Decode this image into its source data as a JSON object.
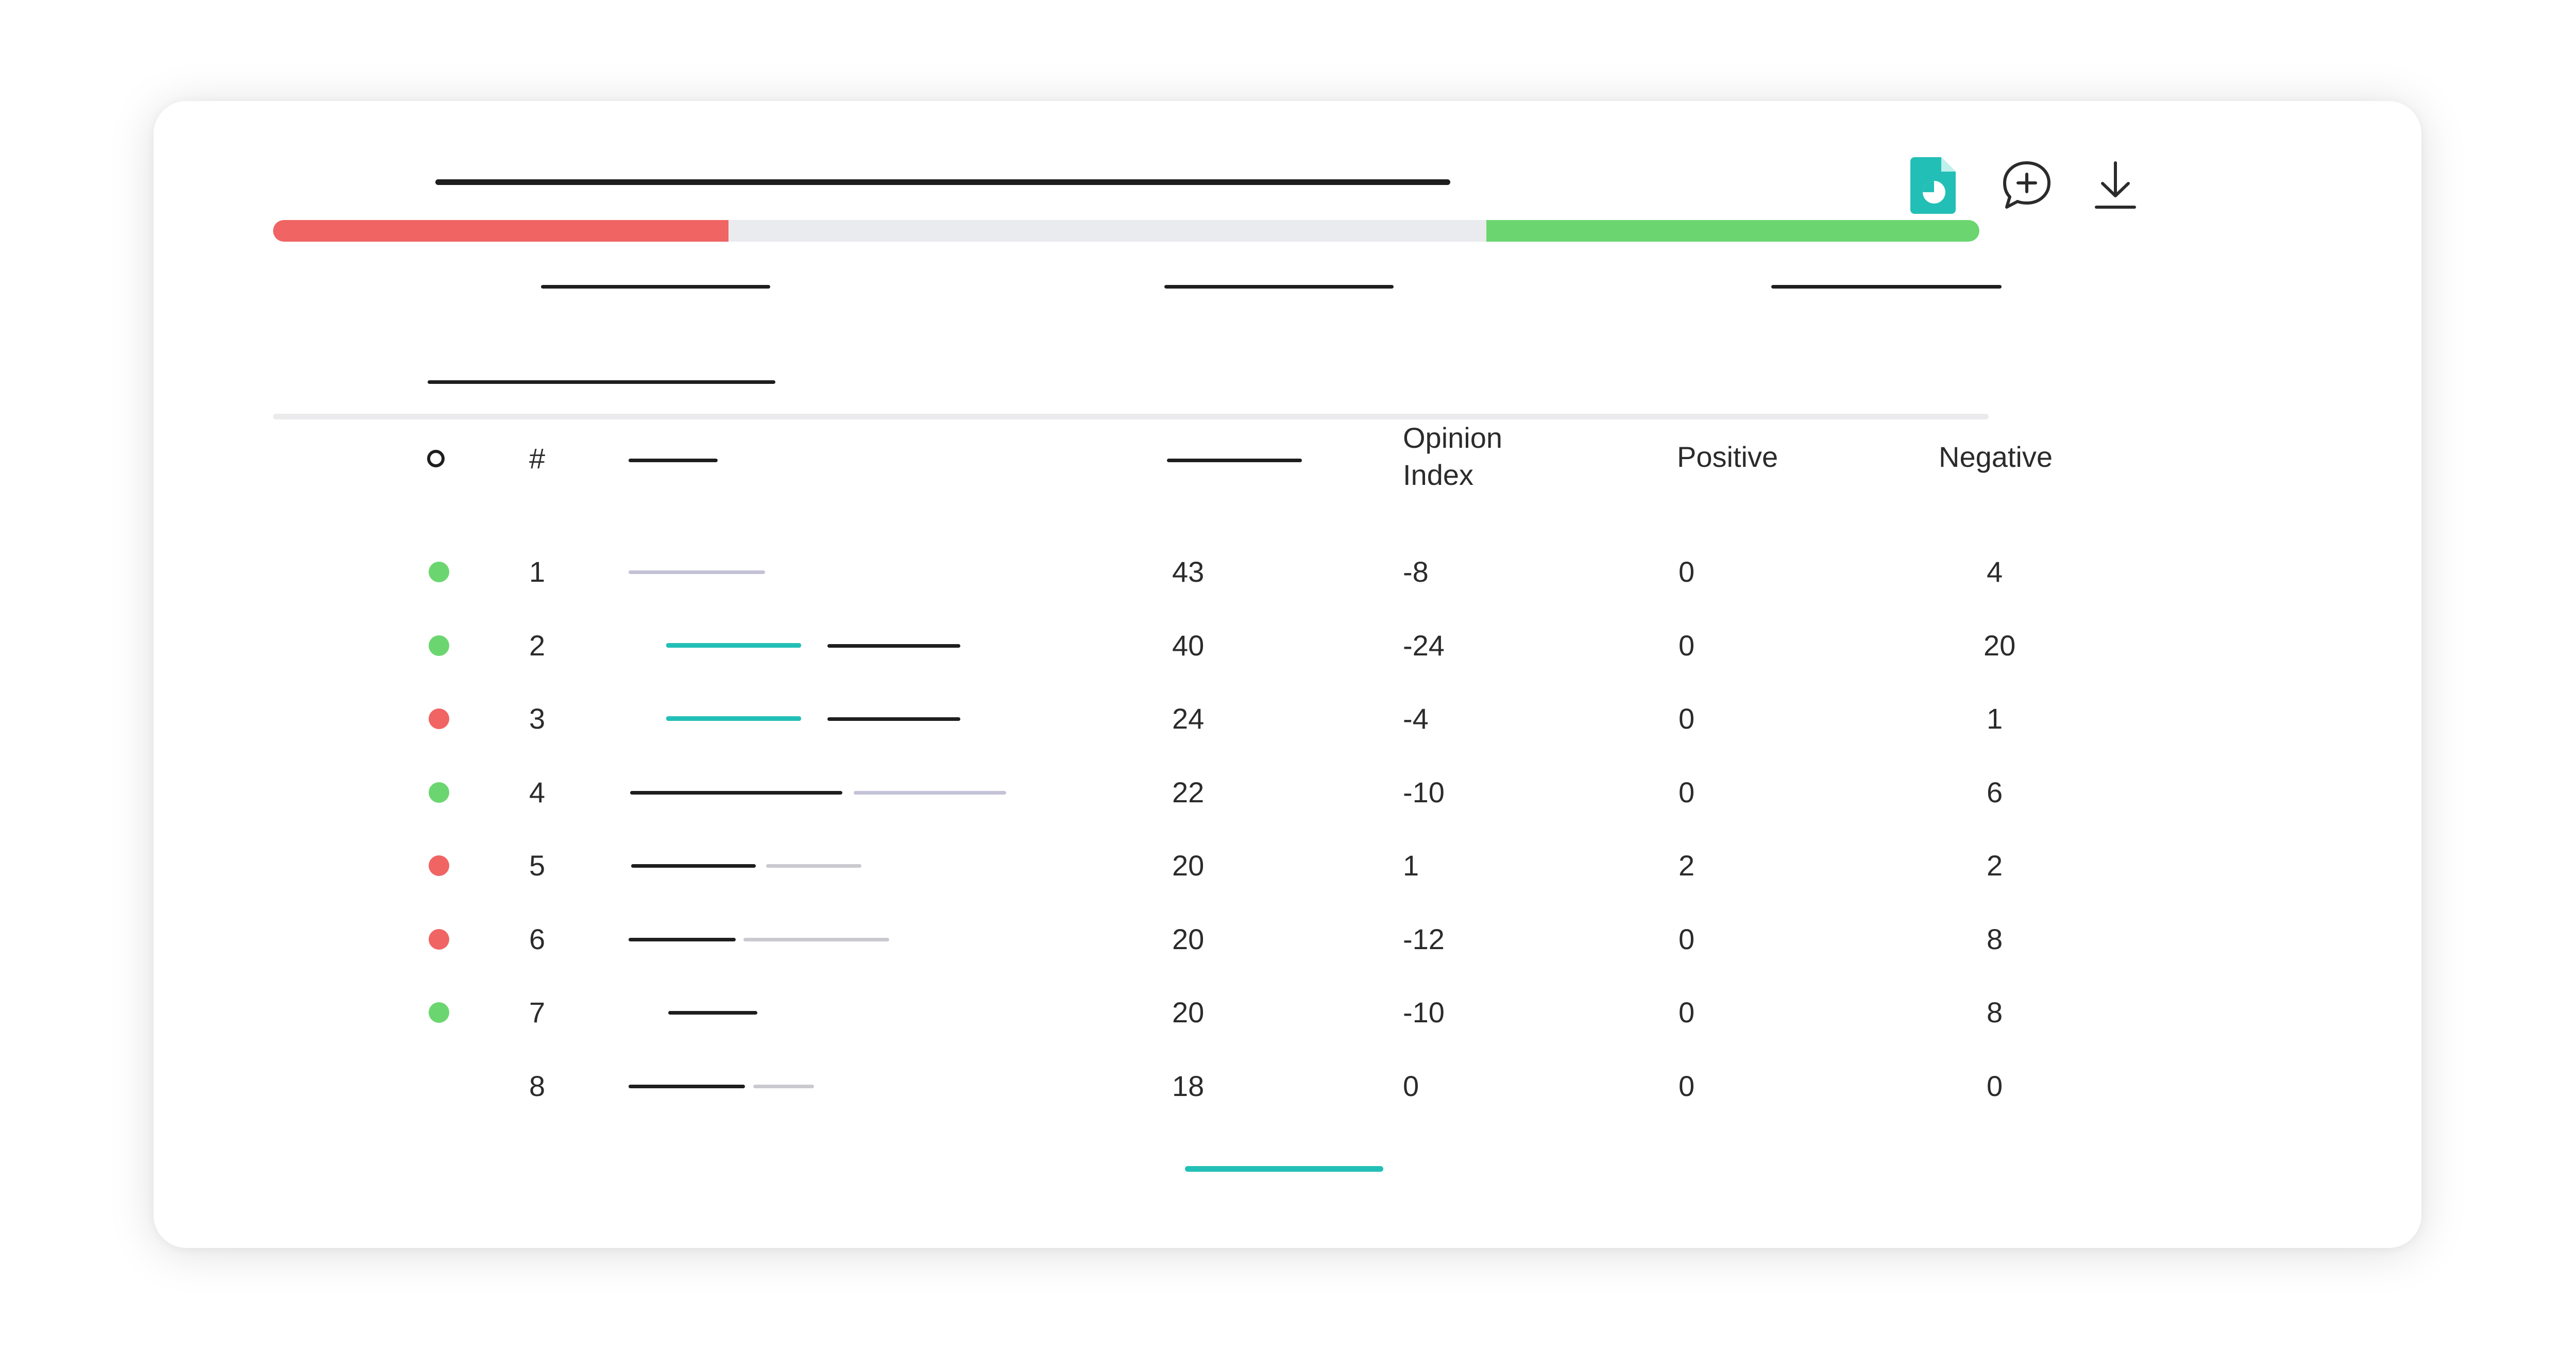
{
  "colors": {
    "accent": "#22bfb6",
    "negative": "#f06464",
    "positive": "#6bd670",
    "neutral_track": "#eaebef"
  },
  "toolbar": {
    "icons": [
      "report-pie-icon",
      "add-comment-icon",
      "download-icon"
    ]
  },
  "sentiment_bar": {
    "negative_fraction": 0.267,
    "neutral_fraction": 0.444,
    "positive_fraction": 0.289
  },
  "table": {
    "headers": {
      "select": "",
      "rank": "#",
      "opinion_index_line1": "Opinion",
      "opinion_index_line2": "Index",
      "positive": "Positive",
      "negative": "Negative"
    },
    "rows": [
      {
        "rank": "1",
        "status": "positive",
        "count": "43",
        "opinion_index": "-8",
        "positive": "0",
        "negative": "4"
      },
      {
        "rank": "2",
        "status": "positive",
        "count": "40",
        "opinion_index": "-24",
        "positive": "0",
        "negative": "20"
      },
      {
        "rank": "3",
        "status": "negative",
        "count": "24",
        "opinion_index": "-4",
        "positive": "0",
        "negative": "1"
      },
      {
        "rank": "4",
        "status": "positive",
        "count": "22",
        "opinion_index": "-10",
        "positive": "0",
        "negative": "6"
      },
      {
        "rank": "5",
        "status": "negative",
        "count": "20",
        "opinion_index": "1",
        "positive": "2",
        "negative": "2"
      },
      {
        "rank": "6",
        "status": "negative",
        "count": "20",
        "opinion_index": "-12",
        "positive": "0",
        "negative": "8"
      },
      {
        "rank": "7",
        "status": "positive",
        "count": "20",
        "opinion_index": "-10",
        "positive": "0",
        "negative": "8"
      },
      {
        "rank": "8",
        "status": "none",
        "count": "18",
        "opinion_index": "0",
        "positive": "0",
        "negative": "0"
      }
    ]
  }
}
